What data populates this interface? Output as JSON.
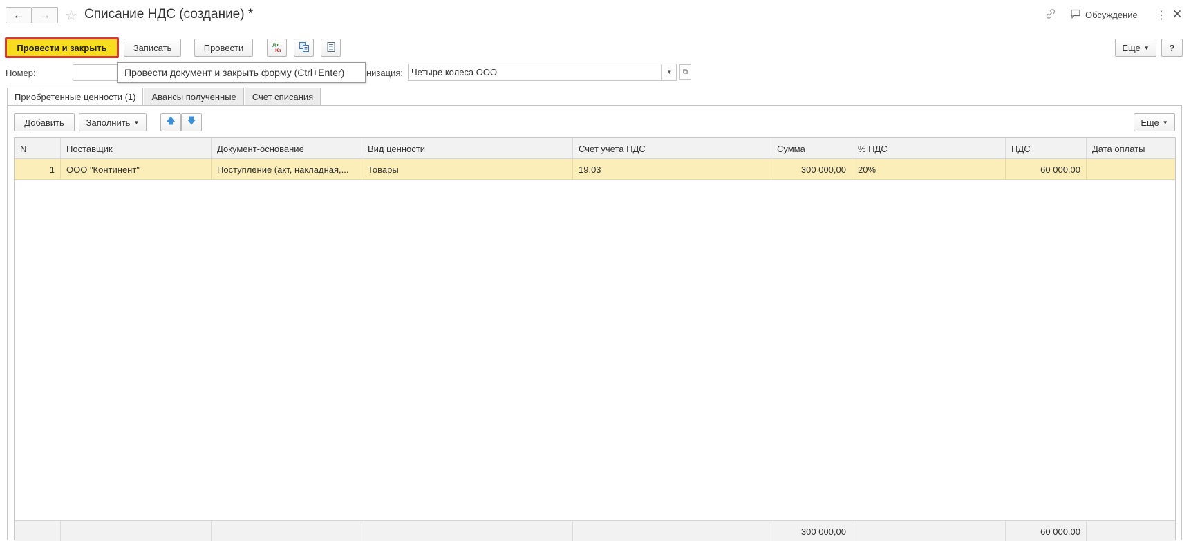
{
  "window": {
    "title": "Списание НДС (создание) *",
    "discussion_label": "Обсуждение",
    "back_icon": "←",
    "forward_icon": "→",
    "favorite_icon": "☆",
    "link_icon": "🔗",
    "more_icon": "⋮",
    "close_icon": "✕"
  },
  "toolbar": {
    "post_and_close": "Провести и закрыть",
    "save": "Записать",
    "post": "Провести",
    "dt_kt": "ДтКт",
    "more": "Еще",
    "help": "?"
  },
  "tooltip": "Провести документ и закрыть форму (Ctrl+Enter)",
  "form": {
    "number_label": "Номер:",
    "number_value": "",
    "org_label_visible": "низация:",
    "org_value": "Четыре колеса ООО"
  },
  "tabs": [
    {
      "label": "Приобретенные ценности (1)",
      "active": true
    },
    {
      "label": "Авансы полученные",
      "active": false
    },
    {
      "label": "Счет списания",
      "active": false
    }
  ],
  "table_toolbar": {
    "add": "Добавить",
    "fill": "Заполнить",
    "more": "Еще"
  },
  "table": {
    "columns": [
      "N",
      "Поставщик",
      "Документ-основание",
      "Вид ценности",
      "Счет учета НДС",
      "Сумма",
      "% НДС",
      "НДС",
      "Дата оплаты"
    ],
    "rows": [
      {
        "n": "1",
        "supplier": "ООО \"Континент\"",
        "doc": "Поступление (акт, накладная,...",
        "kind": "Товары",
        "account": "19.03",
        "sum": "300 000,00",
        "vat_pct": "20%",
        "vat": "60 000,00",
        "pay_date": ""
      }
    ],
    "totals": {
      "sum": "300 000,00",
      "vat": "60 000,00"
    }
  },
  "colors": {
    "primary_button": "#f7dd1d",
    "primary_border": "#d23c35",
    "selected_row": "#fbeeb8"
  }
}
